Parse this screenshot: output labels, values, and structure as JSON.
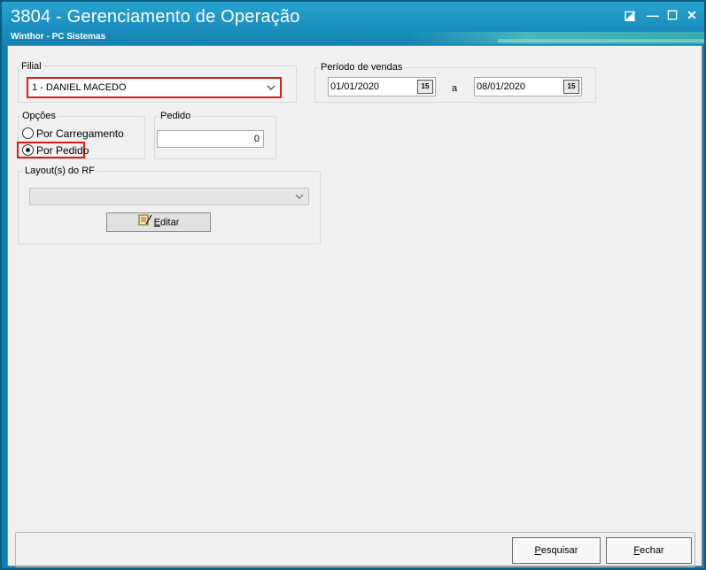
{
  "window": {
    "title": "3804 - Gerenciamento de Operação",
    "subtitle": "Winthor - PC Sistemas",
    "controls": {
      "restore": "◪",
      "minimize": "—",
      "maximize": "☐",
      "close": "✕"
    }
  },
  "filial": {
    "label": "Filial",
    "selected": "1 - DANIEL MACEDO"
  },
  "periodo": {
    "label": "Período de vendas",
    "start": "01/01/2020",
    "separator": "a",
    "end": "08/01/2020",
    "calendar_label": "15"
  },
  "opcoes": {
    "label": "Opções",
    "options": [
      {
        "label": "Por Carregamento",
        "selected": false
      },
      {
        "label": "Por Pedido",
        "selected": true
      }
    ]
  },
  "pedido": {
    "label": "Pedido",
    "value": "0"
  },
  "layout_rf": {
    "label": "Layout(s) do RF",
    "selected": "",
    "edit_button": {
      "label_first": "E",
      "label_rest": "ditar"
    }
  },
  "footer": {
    "search_button": {
      "label_first": "P",
      "label_rest": "esquisar"
    },
    "close_button": {
      "label_first": "F",
      "label_rest": "echar"
    }
  },
  "icons": {
    "edit": "edit-document-icon",
    "calendar": "calendar-icon",
    "dropdown": "chevron-down-icon"
  }
}
